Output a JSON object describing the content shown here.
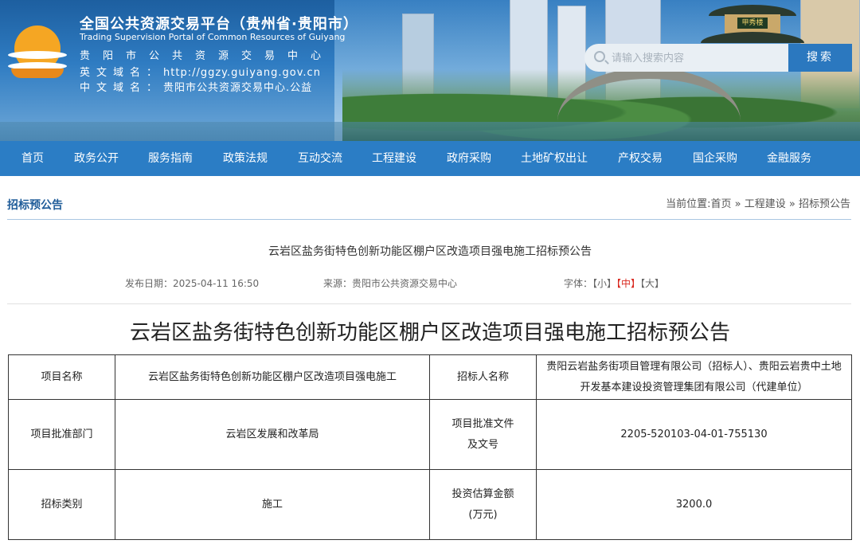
{
  "header": {
    "title": "全国公共资源交易平台（贵州省·贵阳市）",
    "subtitle_en": "Trading Supervision Portal of Common Resources of Guiyang",
    "center_name": "贵阳市公共资源交易中心",
    "en_domain_label": "英文域名：",
    "en_domain_value": "http://ggzy.guiyang.gov.cn",
    "cn_domain_label": "中文域名：",
    "cn_domain_value": "贵阳市公共资源交易中心.公益",
    "plaque_text": "甲秀楼",
    "search": {
      "placeholder": "请输入搜索内容",
      "button_label": "搜索"
    },
    "colors": {
      "banner": "#2f7cc2",
      "nav": "#2b7dc5",
      "search_button": "#2b78bf",
      "logo_sun": "#f5a623"
    }
  },
  "nav": {
    "items": [
      "首页",
      "政务公开",
      "服务指南",
      "政策法规",
      "互动交流",
      "工程建设",
      "政府采购",
      "土地矿权出让",
      "产权交易",
      "国企采购",
      "金融服务"
    ]
  },
  "section": {
    "title": "招标预公告",
    "breadcrumb": "当前位置:首页 » 工程建设 » 招标预公告"
  },
  "article": {
    "title_small": "云岩区盐务街特色创新功能区棚户区改造项目强电施工招标预公告",
    "publish": "发布日期：2025-04-11 16:50",
    "source": "来源：贵阳市公共资源交易中心",
    "font_label": "字体：",
    "font_small": "【小】",
    "font_medium": "【中】",
    "font_large": "【大】",
    "title": "云岩区盐务街特色创新功能区棚户区改造项目强电施工招标预公告"
  },
  "table": {
    "rows": [
      [
        "项目名称",
        "云岩区盐务街特色创新功能区棚户区改造项目强电施工",
        "招标人名称",
        "贵阳云岩盐务街项目管理有限公司（招标人）、贵阳云岩贵中土地开发基本建设投资管理集团有限公司（代建单位）"
      ],
      [
        "项目批准部门",
        "云岩区发展和改革局",
        "项目批准文件及文号",
        "2205-520103-04-01-755130"
      ],
      [
        "招标类别",
        "施工",
        "投资估算金额(万元)",
        "3200.0"
      ]
    ]
  }
}
